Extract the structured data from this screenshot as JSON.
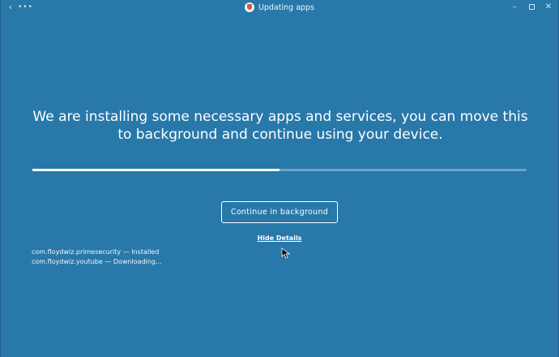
{
  "window": {
    "title": "Updating apps",
    "back_glyph": "‹",
    "more_glyph": "•••",
    "minimize_glyph": "–",
    "close_glyph": "✕",
    "app_icon": "download-app-icon"
  },
  "main": {
    "message": "We are installing some necessary apps and services, you can move this to background and continue using your device.",
    "progress": 0.5,
    "continue_label": "Continue in background",
    "hide_details_label": "Hide Details",
    "details": [
      "com.floydwiz.primesecurity — Installed",
      "com.floydwiz.youtube — Downloading..."
    ]
  },
  "colors": {
    "background": "#2878aa",
    "progress_track": "#6fa3c7",
    "progress_fill": "#ffffff",
    "text": "#ffffff"
  }
}
